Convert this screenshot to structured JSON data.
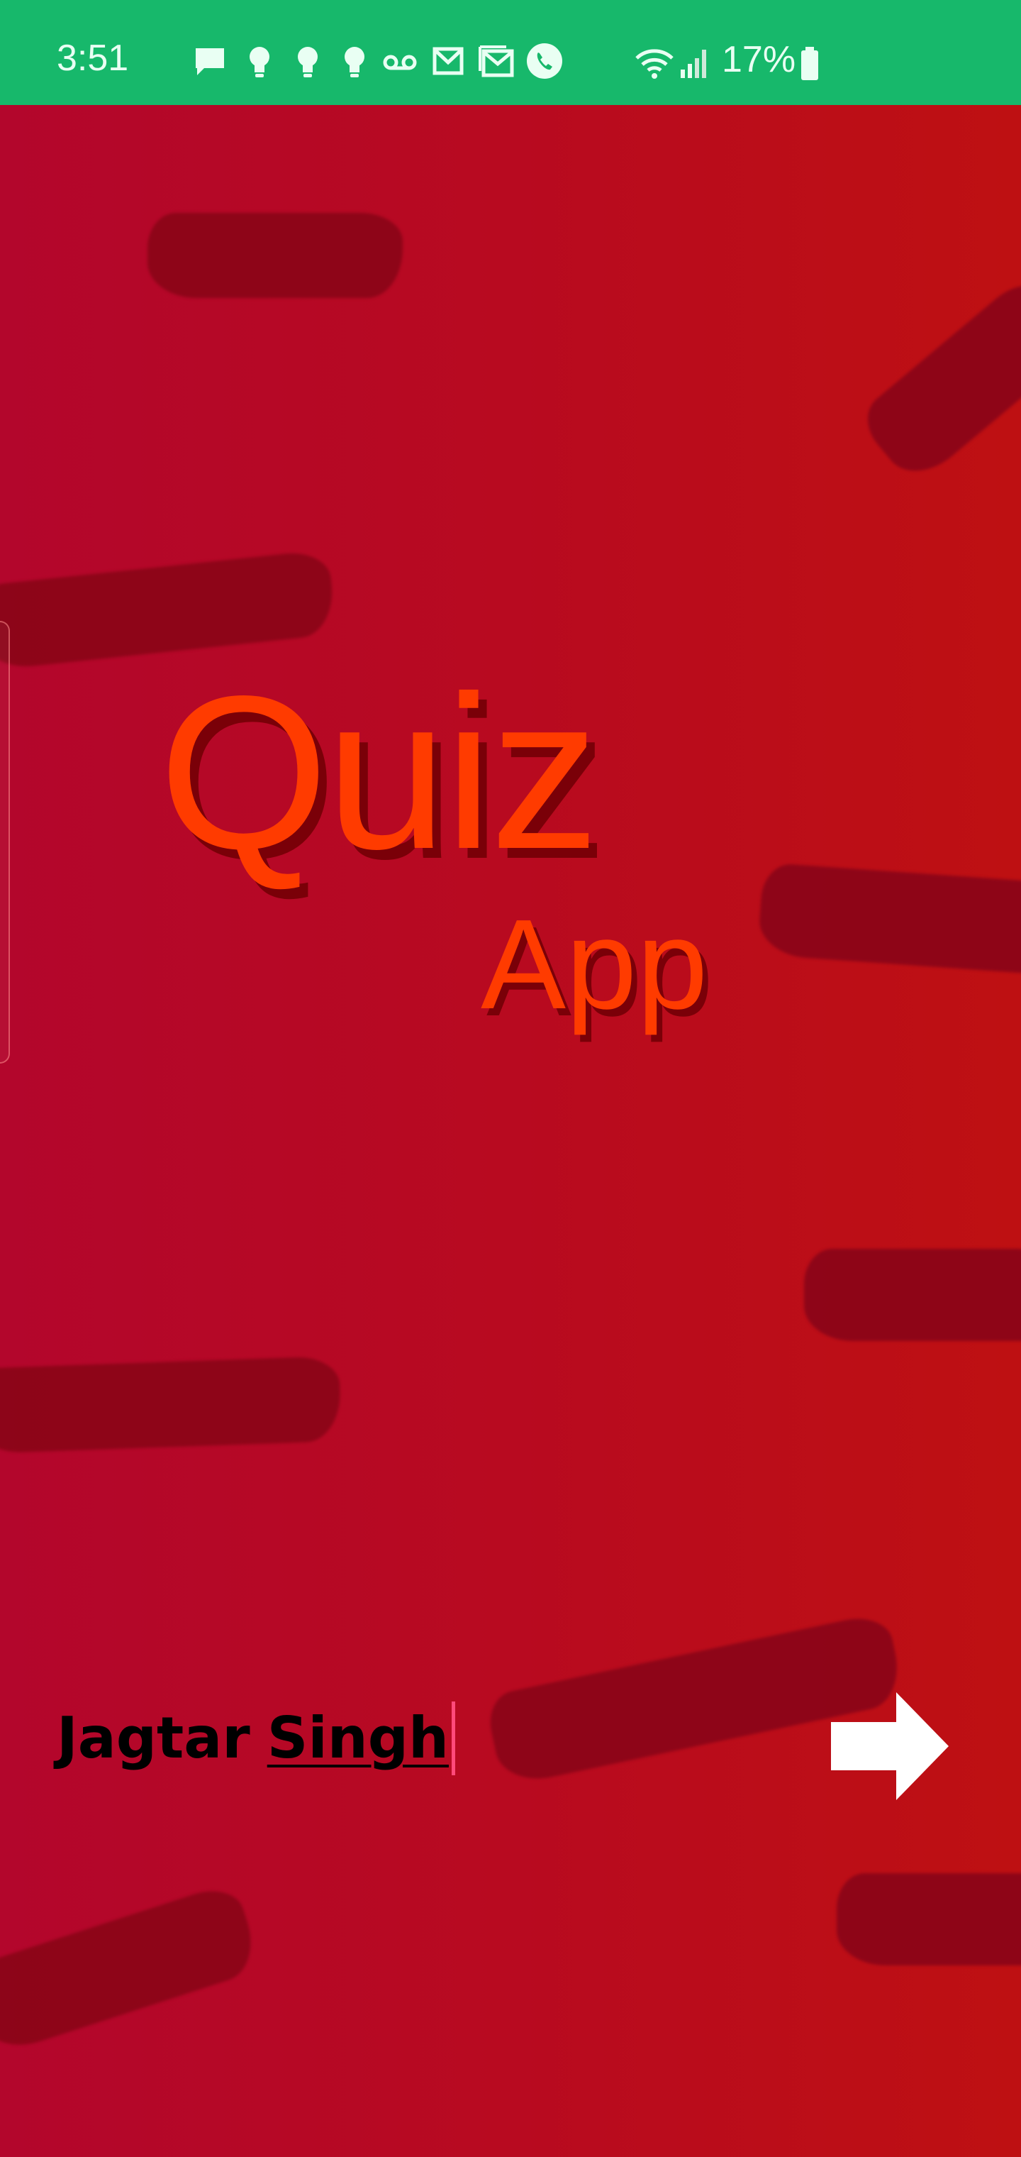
{
  "status_bar": {
    "time": "3:51",
    "battery_percent": "17%",
    "notification_icons": [
      "message-icon",
      "bulb-icon",
      "bulb-icon",
      "bulb-icon",
      "voicemail-icon",
      "gmail-icon",
      "gmail-icon",
      "phone-icon"
    ],
    "system_icons": [
      "wifi-icon",
      "signal-icon",
      "battery-icon"
    ],
    "color": "#17b86b"
  },
  "title": {
    "main": "Quiz",
    "sub": "App",
    "color": "#ff3b00"
  },
  "name_input": {
    "first": "Jagtar",
    "last": "Singh"
  },
  "next_button": {
    "icon": "arrow-right-icon",
    "color": "#ffffff"
  },
  "background": {
    "gradient": [
      "#b3062c",
      "#be1012"
    ],
    "stroke_color": "#8c0518"
  }
}
